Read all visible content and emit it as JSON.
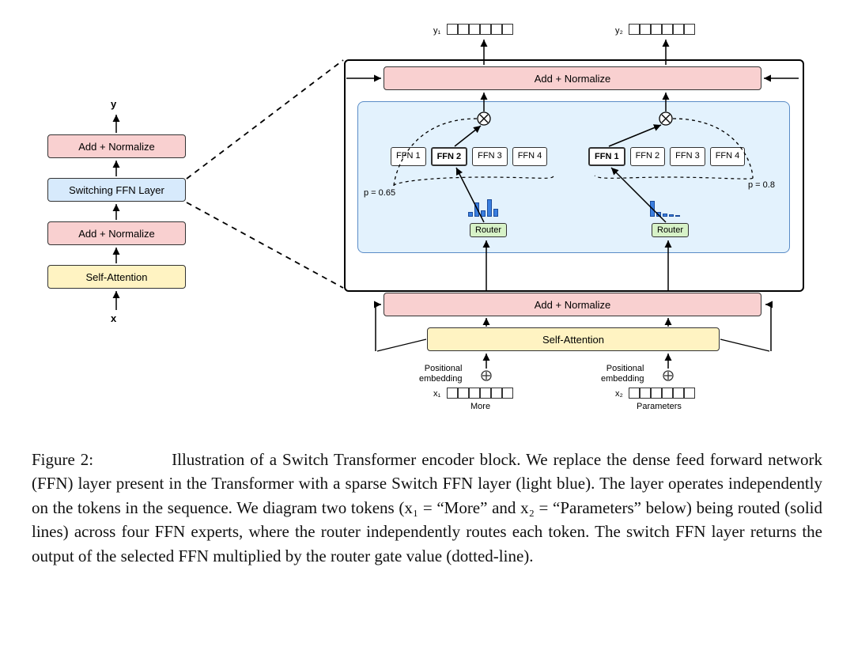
{
  "left_stack": {
    "y_label": "y",
    "x_label": "x",
    "blocks": [
      "Add + Normalize",
      "Switching FFN Layer",
      "Add + Normalize",
      "Self-Attention"
    ]
  },
  "right": {
    "y1_label": "y₁",
    "y2_label": "y₂",
    "x1_label": "x₁",
    "x2_label": "x₂",
    "token1_word": "More",
    "token2_word": "Parameters",
    "add_norm_top": "Add + Normalize",
    "add_norm_bottom": "Add + Normalize",
    "self_attention": "Self-Attention",
    "router_label": "Router",
    "p_left": "p = 0.65",
    "p_right": "p = 0.8",
    "pos_embed": "Positional\nembedding",
    "ffns": [
      "FFN 1",
      "FFN 2",
      "FFN 3",
      "FFN 4"
    ],
    "selected_left_index": 1,
    "selected_right_index": 0,
    "bar_heights_left": [
      6,
      18,
      8,
      22,
      10
    ],
    "bar_heights_right": [
      20,
      6,
      4,
      3,
      2
    ]
  },
  "caption": {
    "prefix": "Figure 2: ",
    "body": "Illustration of a Switch Transformer encoder block. We replace the dense feed forward network (FFN) layer present in the Transformer with a sparse Switch FFN layer (light blue). The layer operates independently on the tokens in the sequence. We diagram two tokens (x₁ = “More” and x₂ = “Parameters” below) being routed (solid lines) across four FFN experts, where the router independently routes each token. The switch FFN layer returns the output of the selected FFN multiplied by the router gate value (dotted-line)."
  }
}
